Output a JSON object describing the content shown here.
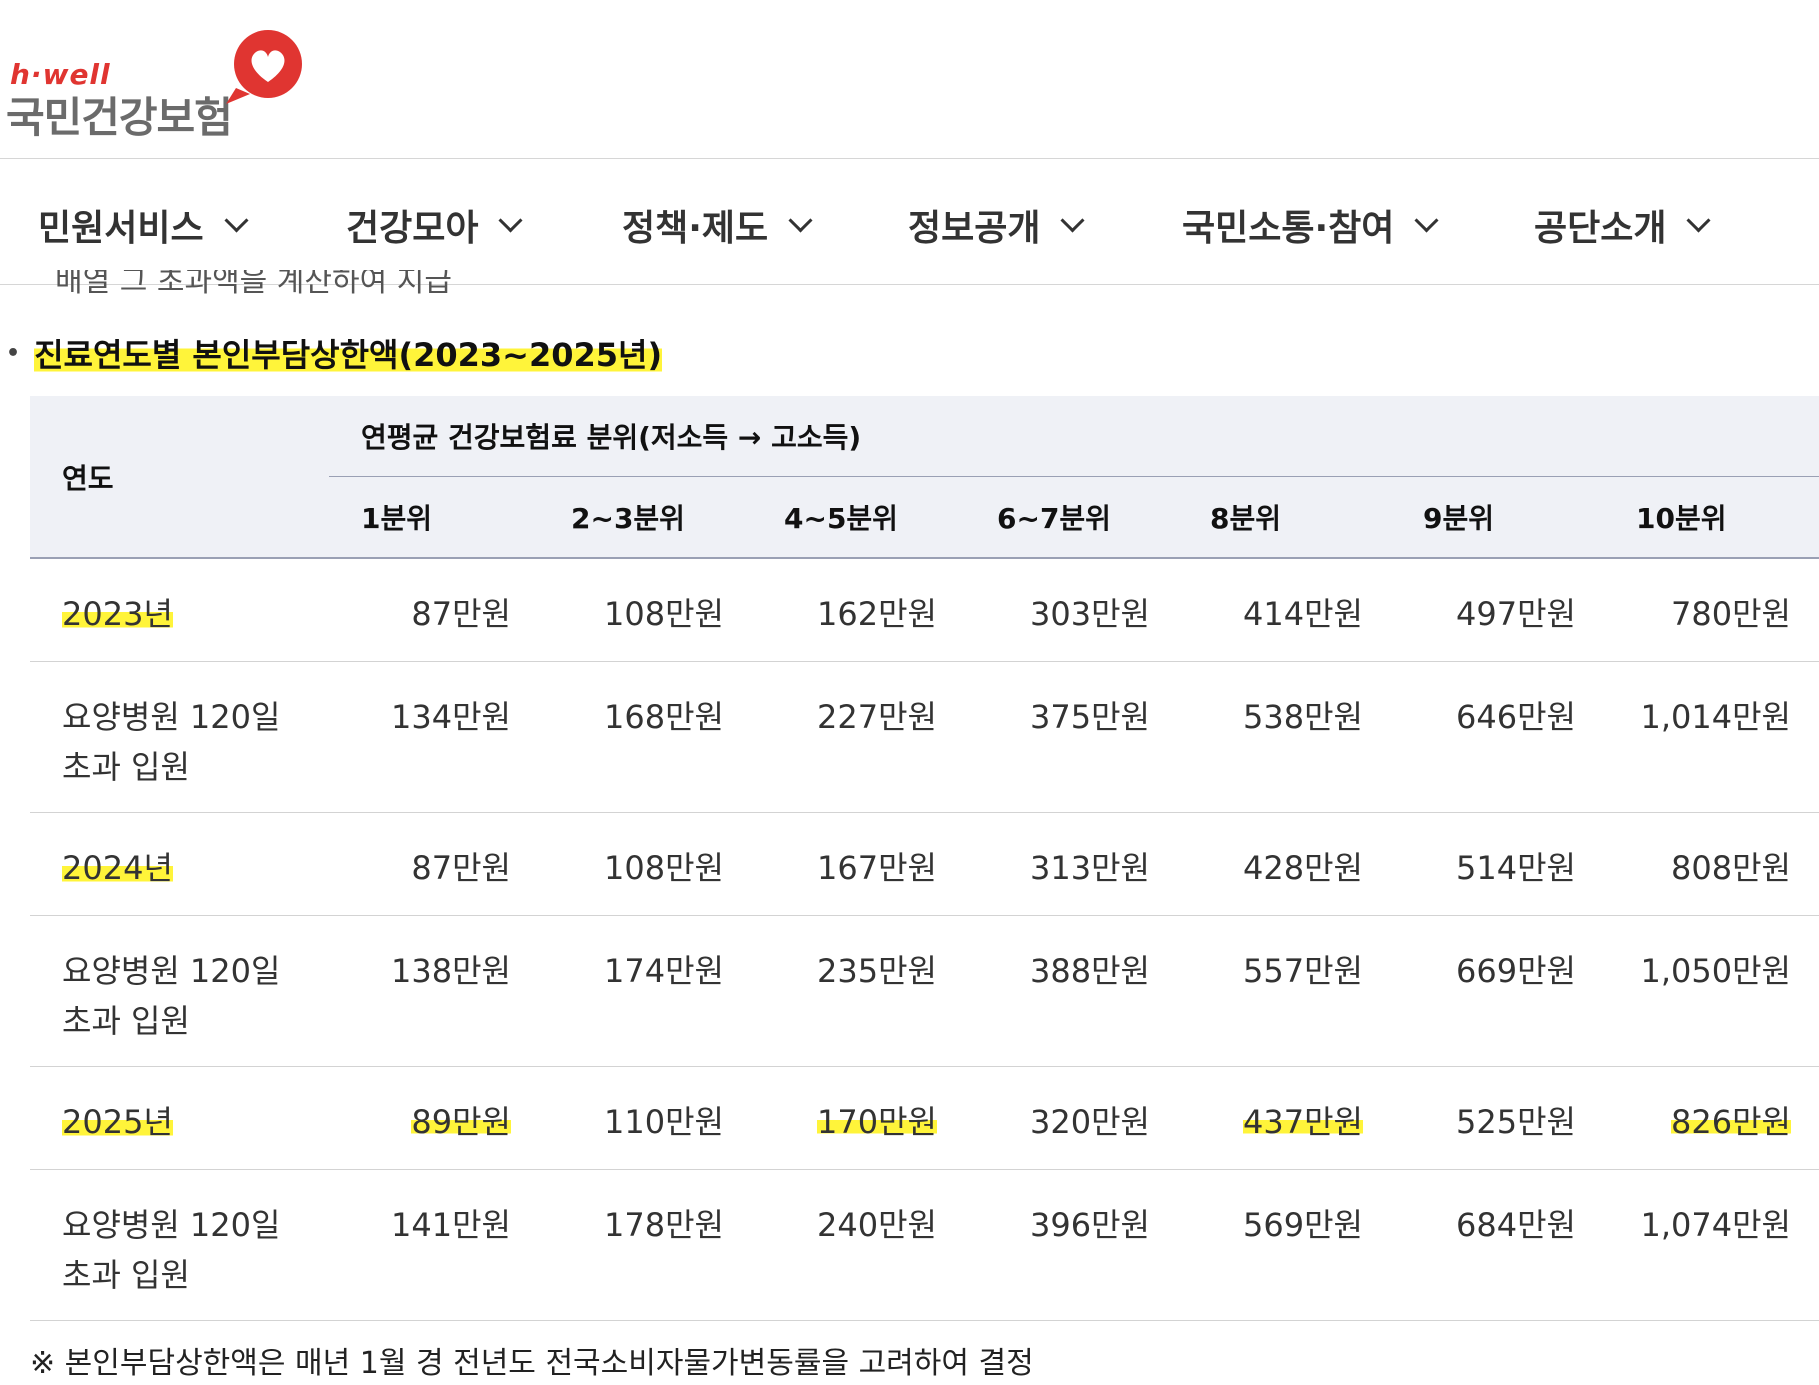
{
  "logo": {
    "small": "h·well",
    "main": "국민건강보험"
  },
  "nav": {
    "items": [
      {
        "label": "민원서비스"
      },
      {
        "label": "건강모아"
      },
      {
        "label": "정책·제도"
      },
      {
        "label": "정보공개"
      },
      {
        "label": "국민소통·참여"
      },
      {
        "label": "공단소개"
      }
    ]
  },
  "cut_text": "배열 그 초과액을 계산하여 지급",
  "section_title": "진료연도별 본인부담상한액(2023~2025년)",
  "table": {
    "year_header": "연도",
    "group_header": "연평균 건강보험료 분위(저소득 → 고소득)",
    "columns": [
      "1분위",
      "2~3분위",
      "4~5분위",
      "6~7분위",
      "8분위",
      "9분위",
      "10분위"
    ],
    "rows": [
      {
        "label": "2023년",
        "values": [
          "87만원",
          "108만원",
          "162만원",
          "303만원",
          "414만원",
          "497만원",
          "780만원"
        ]
      },
      {
        "label": "요양병원 120일 초과 입원",
        "values": [
          "134만원",
          "168만원",
          "227만원",
          "375만원",
          "538만원",
          "646만원",
          "1,014만원"
        ]
      },
      {
        "label": "2024년",
        "values": [
          "87만원",
          "108만원",
          "167만원",
          "313만원",
          "428만원",
          "514만원",
          "808만원"
        ]
      },
      {
        "label": "요양병원 120일 초과 입원",
        "values": [
          "138만원",
          "174만원",
          "235만원",
          "388만원",
          "557만원",
          "669만원",
          "1,050만원"
        ]
      },
      {
        "label": "2025년",
        "values": [
          "89만원",
          "110만원",
          "170만원",
          "320만원",
          "437만원",
          "525만원",
          "826만원"
        ]
      },
      {
        "label": "요양병원 120일 초과 입원",
        "values": [
          "141만원",
          "178만원",
          "240만원",
          "396만원",
          "569만원",
          "684만원",
          "1,074만원"
        ]
      }
    ]
  },
  "footnote": "※ 본인부담상한액은 매년 1월 경 전년도 전국소비자물가변동률을 고려하여 결정",
  "colors": {
    "brand_red": "#e03531",
    "highlight": "#fff43a",
    "header_bg": "#eff1f6"
  }
}
